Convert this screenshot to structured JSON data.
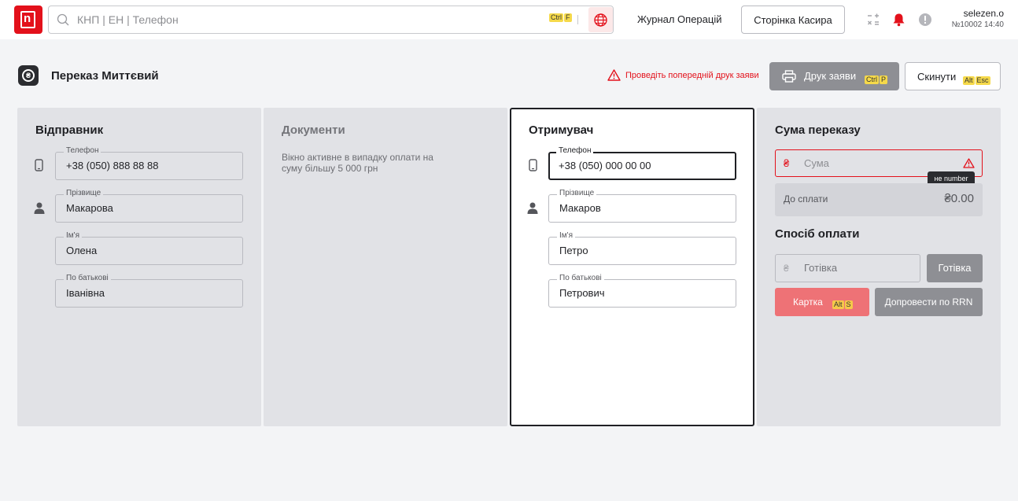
{
  "topbar": {
    "logo_letter": "n",
    "search_placeholder": "КНП | ЕН | Телефон",
    "search_kbd": [
      "Ctrl",
      "F"
    ],
    "operations_journal": "Журнал Операцій",
    "cashier_page": "Сторінка Касира",
    "user": {
      "name": "selezen.o",
      "meta": "№10002 14:40"
    }
  },
  "header": {
    "title": "Переказ Миттєвий",
    "page_icon_symbol": "₴",
    "warning": "Проведіть попередній друк заяви",
    "print_button": {
      "label": "Друк заяви",
      "kbd": [
        "Ctrl",
        "P"
      ]
    },
    "reset_button": {
      "label": "Скинути",
      "kbd": [
        "Alt",
        "Esc"
      ]
    }
  },
  "sender": {
    "title": "Відправник",
    "fields": [
      {
        "label": "Телефон",
        "value": "+38 (050) 888 88 88"
      },
      {
        "label": "Прізвище",
        "value": "Макарова"
      },
      {
        "label": "Ім'я",
        "value": "Олена"
      },
      {
        "label": "По батькові",
        "value": "Іванівна"
      }
    ]
  },
  "documents": {
    "title": "Документи",
    "note": "Вікно активне в випадку оплати на суму більшу 5 000 грн"
  },
  "recipient": {
    "title": "Отримувач",
    "fields": [
      {
        "label": "Телефон",
        "value": "+38 (050) 000 00 00"
      },
      {
        "label": "Прізвище",
        "value": "Макаров"
      },
      {
        "label": "Ім'я",
        "value": "Петро"
      },
      {
        "label": "По батькові",
        "value": "Петрович"
      }
    ]
  },
  "sum": {
    "title": "Сума переказу",
    "currency": "₴",
    "placeholder": "Сума",
    "tooltip": "не number",
    "to_pay_label": "До сплати",
    "to_pay_value": "₴0.00",
    "payment_title": "Спосіб оплати",
    "cash_placeholder": "Готівка",
    "cash_button": "Готівка",
    "card_button": {
      "label": "Картка",
      "kbd": [
        "Alt",
        "S"
      ]
    },
    "rrn_button": "Допровести по RRN"
  },
  "colors": {
    "brand": "#e3111b",
    "card": "#ee7276",
    "kbd": "#f5d94a"
  }
}
